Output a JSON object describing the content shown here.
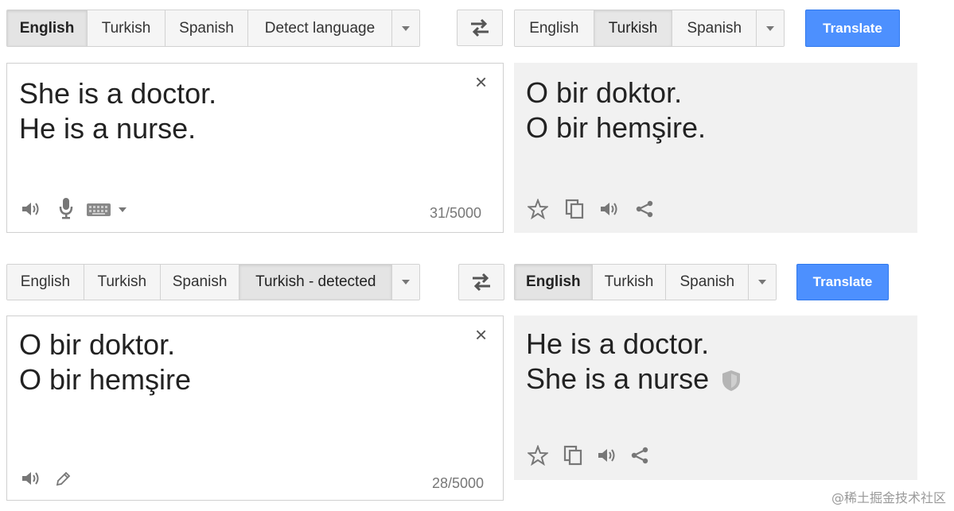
{
  "top": {
    "source_tabs": [
      "English",
      "Turkish",
      "Spanish",
      "Detect language"
    ],
    "target_tabs": [
      "English",
      "Turkish",
      "Spanish"
    ],
    "translate_label": "Translate",
    "source_lines": [
      "She is a doctor.",
      "He is a nurse."
    ],
    "output_lines": [
      "O bir doktor.",
      "O bir hemşire."
    ],
    "counter": "31/5000"
  },
  "bottom": {
    "source_tabs": [
      "English",
      "Turkish",
      "Spanish",
      "Turkish - detected"
    ],
    "target_tabs": [
      "English",
      "Turkish",
      "Spanish"
    ],
    "translate_label": "Translate",
    "source_lines": [
      "O bir doktor.",
      "O bir hemşire"
    ],
    "output_lines": [
      "He is a doctor.",
      "She is a nurse"
    ],
    "counter": "28/5000"
  },
  "close_symbol": "×",
  "watermark": "@稀土掘金技术社区",
  "colors": {
    "translate_blue": "#4d90fe",
    "output_bg": "#f1f1f1",
    "icon_gray": "#777777"
  },
  "icons": [
    "swap-icon",
    "speaker-icon",
    "mic-icon",
    "keyboard-icon",
    "star-icon",
    "copy-icon",
    "share-icon",
    "pencil-icon",
    "shield-icon",
    "chevron-down-icon",
    "close-icon"
  ]
}
